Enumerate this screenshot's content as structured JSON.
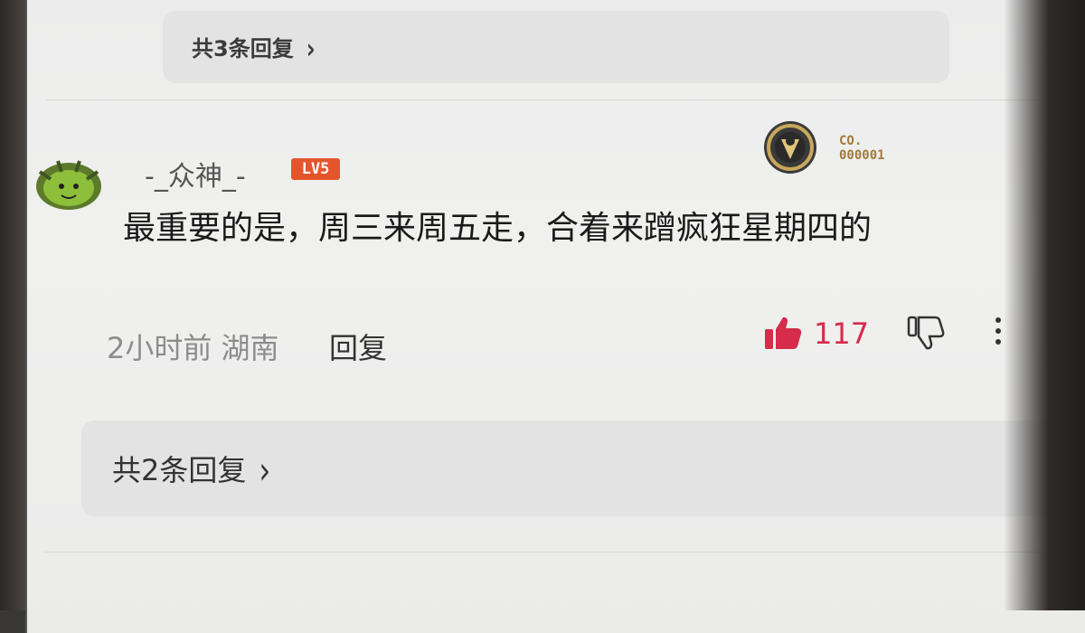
{
  "thread": {
    "previous_replies_label": "共3条回复",
    "replies_label": "共2条回复"
  },
  "comment": {
    "username": "-_众神_-",
    "level": "LV5",
    "team_code_line1": "CO.",
    "team_code_line2": "000001",
    "text": "最重要的是，周三来周五走，合着来蹭疯狂星期四的",
    "time_location": "2小时前 湖南",
    "reply_label": "回复",
    "like_count": "117"
  },
  "icons": {
    "chevron": "chevron-right-icon",
    "like": "thumbs-up-icon",
    "dislike": "thumbs-down-icon",
    "more": "more-vertical-icon"
  },
  "colors": {
    "like_accent": "#d62b4a",
    "level_badge": "#e5552c",
    "team_gold": "#a07a3a"
  }
}
